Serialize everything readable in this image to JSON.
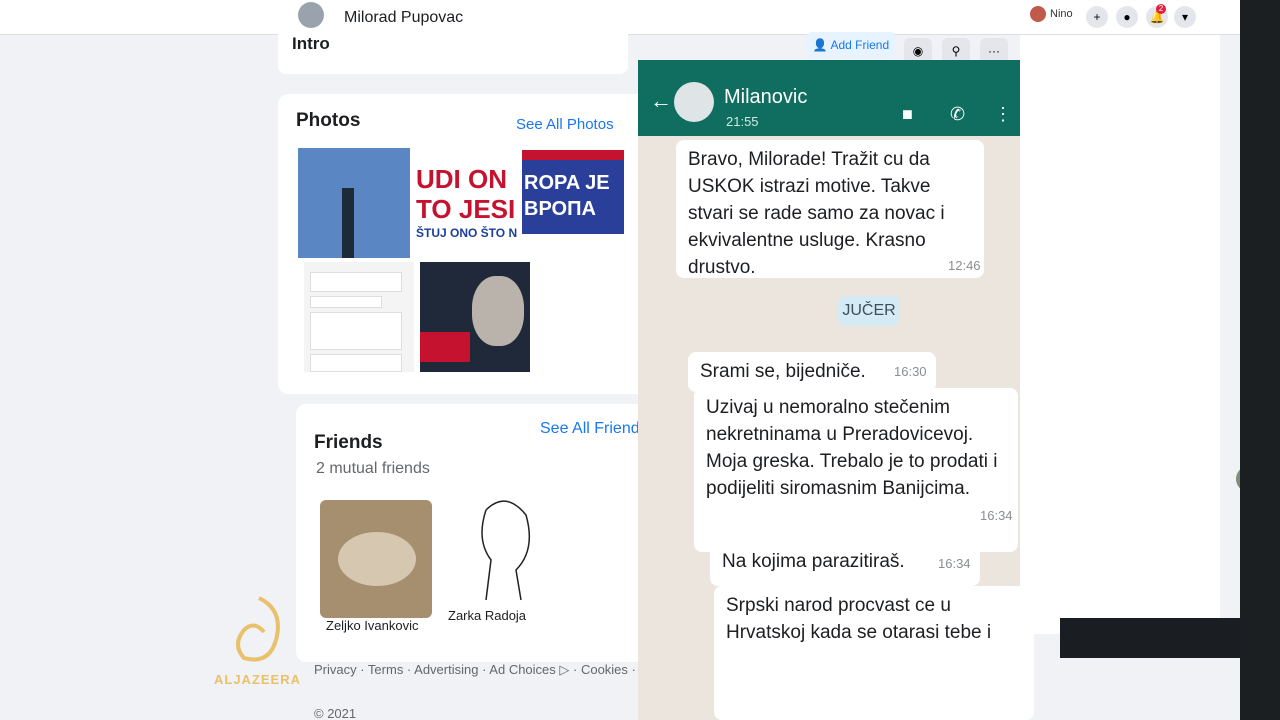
{
  "topbar": {
    "profile_name": "Milorad Pupovac",
    "user_name": "Nino",
    "notification_count": "2"
  },
  "profile_actions": {
    "add_friend": "Add Friend"
  },
  "intro": {
    "label": "Intro"
  },
  "photos": {
    "title": "Photos",
    "see_all": "See All Photos",
    "thumb_texts": [
      "UDI ON",
      "TO JESI",
      "ŠTUJ ONO ŠTO N",
      "ROPA JE",
      "ВРОПА"
    ]
  },
  "friends": {
    "title": "Friends",
    "mutual": "2 mutual friends",
    "see_all": "See All Friends",
    "list": [
      {
        "name": "Zeljko Ivankovic"
      },
      {
        "name": "Zarka Radoja"
      }
    ]
  },
  "footer": {
    "links": "Privacy · Terms · Advertising · Ad Choices ▷ · Cookies · More ·",
    "copyright": "© 2021"
  },
  "whatsapp": {
    "contact": "Milanovic",
    "time": "21:55",
    "day_label": "JUČER",
    "messages": [
      {
        "text": "Bravo, Milorade! Tražit cu da USKOK istrazi motive.  Takve stvari se rade samo za novac i ekvivalentne usluge. Krasno drustvo.",
        "time": "12:46"
      },
      {
        "text": "Srami se, bijedniče.",
        "time": "16:30"
      },
      {
        "text": "Uzivaj u nemoralno stečenim nekretninama u Preradovicevoj. Moja greska. Trebalo je to prodati i podijeliti siromasnim Banijcima.",
        "time": "16:34"
      },
      {
        "text": "Na kojima parazitiraš.",
        "time": "16:34"
      },
      {
        "text": "Srpski narod procvast ce u Hrvatskoj kada se otarasi tebe i",
        "time": ""
      }
    ]
  },
  "overlay": {
    "channel_logo_text": "ALJAZEERA"
  },
  "colors": {
    "facebook_blue": "#1877f2",
    "whatsapp_header": "#0f6e5f",
    "chat_background": "#ece5dd"
  }
}
